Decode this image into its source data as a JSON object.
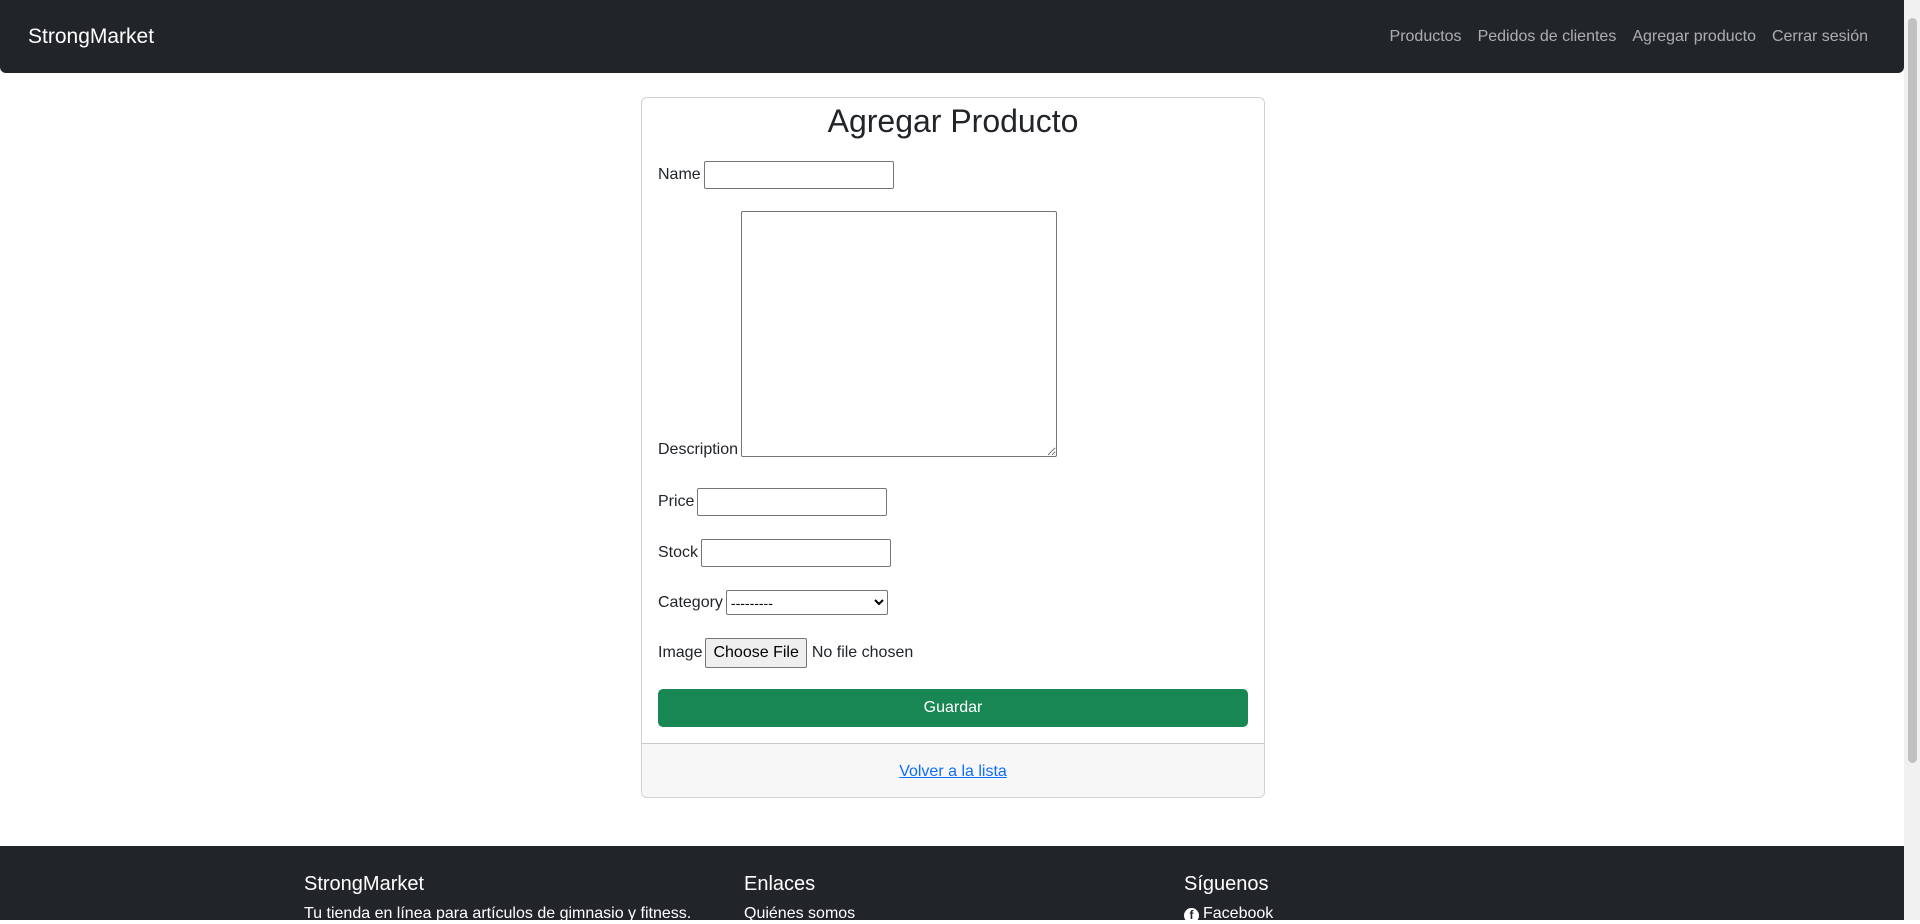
{
  "navbar": {
    "brand": "StrongMarket",
    "links": [
      "Productos",
      "Pedidos de clientes",
      "Agregar producto",
      "Cerrar sesión"
    ]
  },
  "form": {
    "title": "Agregar Producto",
    "name_label": "Name",
    "description_label": "Description",
    "price_label": "Price",
    "stock_label": "Stock",
    "category_label": "Category",
    "category_selected": "---------",
    "image_label": "Image",
    "file_button": "Choose File",
    "file_status": "No file chosen",
    "submit_label": "Guardar",
    "back_link": "Volver a la lista"
  },
  "footer": {
    "col1": {
      "title": "StrongMarket",
      "text": "Tu tienda en línea para artículos de gimnasio y fitness."
    },
    "col2": {
      "title": "Enlaces",
      "link1": "Quiénes somos"
    },
    "col3": {
      "title": "Síguenos",
      "facebook": "Facebook"
    }
  },
  "colors": {
    "navbar_bg": "#212529",
    "success": "#198754",
    "link": "#0d6efd"
  },
  "icons": {
    "facebook": "facebook-icon"
  }
}
